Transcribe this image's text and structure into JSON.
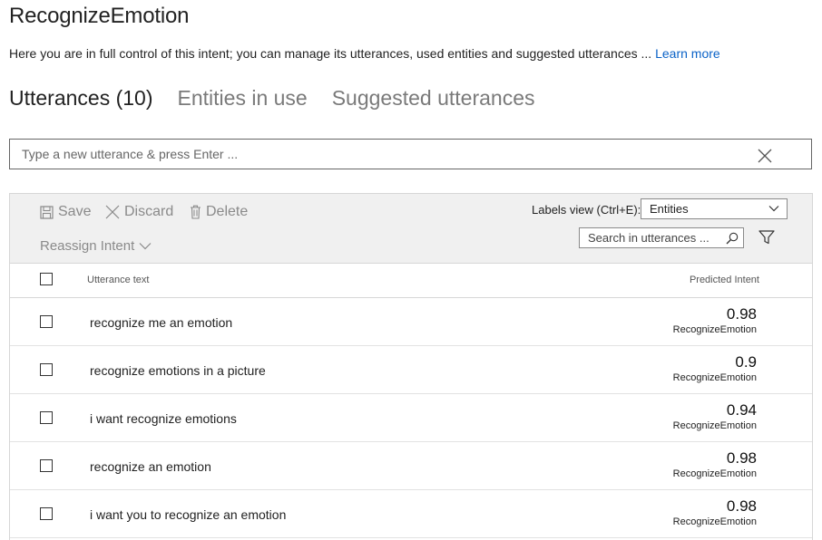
{
  "page": {
    "title": "RecognizeEmotion",
    "description": "Here you are in full control of this intent; you can manage its utterances, used entities and suggested utterances ... ",
    "learn_more": "Learn more"
  },
  "tabs": [
    {
      "label": "Utterances (10)",
      "active": true
    },
    {
      "label": "Entities in use",
      "active": false
    },
    {
      "label": "Suggested utterances",
      "active": false
    }
  ],
  "utterance_input": {
    "placeholder": "Type a new utterance & press Enter ...",
    "value": ""
  },
  "toolbar": {
    "save_label": "Save",
    "discard_label": "Discard",
    "delete_label": "Delete",
    "reassign_label": "Reassign Intent",
    "labels_view_label": "Labels view (Ctrl+E):",
    "labels_view_value": "Entities",
    "search_placeholder": "Search in utterances ..."
  },
  "table": {
    "col_text": "Utterance text",
    "col_intent": "Predicted Intent",
    "rows": [
      {
        "text": "recognize me an emotion",
        "score": "0.98",
        "intent": "RecognizeEmotion"
      },
      {
        "text": "recognize emotions in a picture",
        "score": "0.9",
        "intent": "RecognizeEmotion"
      },
      {
        "text": "i want recognize emotions",
        "score": "0.94",
        "intent": "RecognizeEmotion"
      },
      {
        "text": "recognize an emotion",
        "score": "0.98",
        "intent": "RecognizeEmotion"
      },
      {
        "text": "i want you to recognize an emotion",
        "score": "0.98",
        "intent": "RecognizeEmotion"
      }
    ]
  },
  "colors": {
    "link": "#0a62c7",
    "toolbar_bg": "#f0f0f0",
    "disabled_text": "#8a8a8a"
  }
}
